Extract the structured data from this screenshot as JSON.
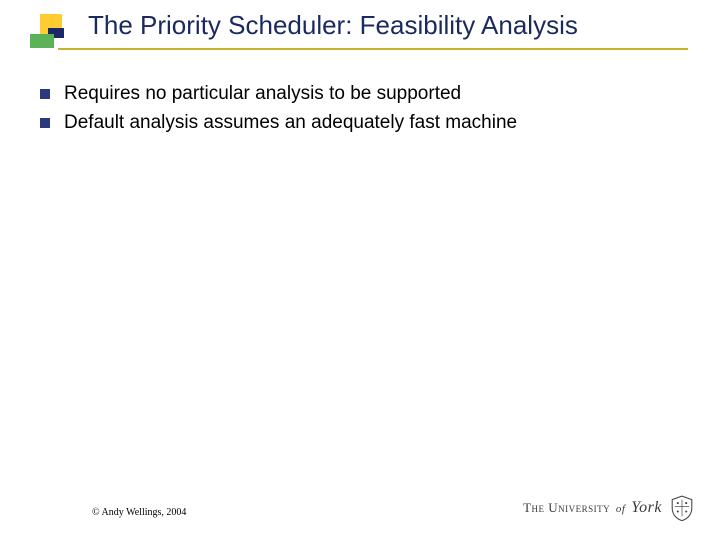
{
  "title": "The Priority Scheduler: Feasibility Analysis",
  "bullets": [
    "Requires no particular analysis to be supported",
    "Default analysis assumes an adequately fast machine"
  ],
  "copyright": "© Andy Wellings, 2004",
  "university": {
    "prefix": "The University",
    "of": "of",
    "name": "York"
  }
}
